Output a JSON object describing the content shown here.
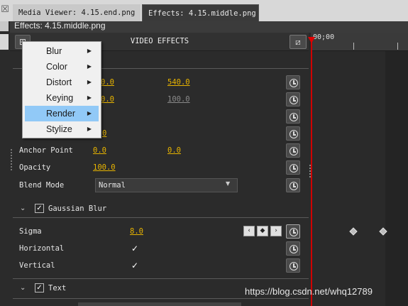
{
  "tabs": [
    {
      "label": "Media Viewer: 4.15.end.png"
    },
    {
      "label": "Effects: 4.15.middle.png"
    }
  ],
  "panel": {
    "title": "Effects: 4.15.middle.png"
  },
  "header": {
    "title": "VIDEO EFFECTS"
  },
  "timeline": {
    "timecode": "00;00"
  },
  "menu": {
    "items": [
      {
        "label": "Blur"
      },
      {
        "label": "Color"
      },
      {
        "label": "Distort"
      },
      {
        "label": "Keying"
      },
      {
        "label": "Render",
        "selected": true
      },
      {
        "label": "Stylize"
      }
    ]
  },
  "properties": {
    "row1": {
      "v1": "0.0",
      "v2": "540.0"
    },
    "row2": {
      "v1": "0.0",
      "v2": "100.0"
    },
    "row5": {
      "v1": "0"
    },
    "anchor": {
      "label": "Anchor Point",
      "v1": "0.0",
      "v2": "0.0"
    },
    "opacity": {
      "label": "Opacity",
      "value": "100.0"
    },
    "blend": {
      "label": "Blend Mode",
      "value": "Normal"
    }
  },
  "gaussian": {
    "label": "Gaussian Blur",
    "sigma": {
      "label": "Sigma",
      "value": "8.0"
    },
    "horizontal": {
      "label": "Horizontal"
    },
    "vertical": {
      "label": "Vertical"
    }
  },
  "text_section": {
    "label": "Text"
  },
  "watermark": "https://blog.csdn.net/whq12789",
  "colors": {
    "accent": "#e8b400",
    "playhead": "#d00000",
    "menu_highlight": "#91c9f7"
  }
}
